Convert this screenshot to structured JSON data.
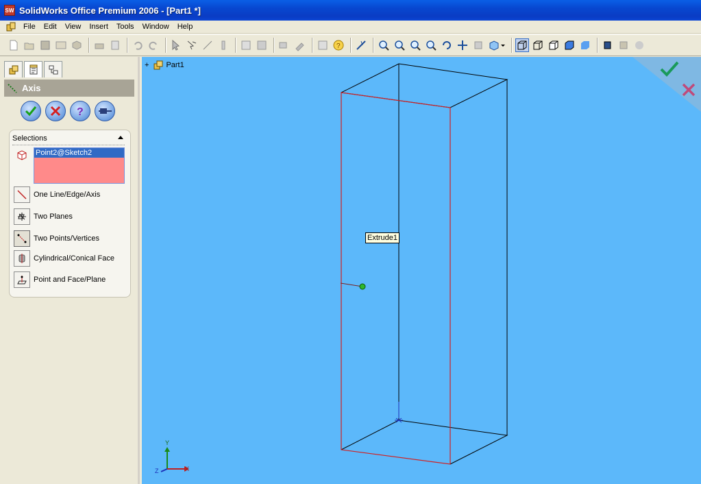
{
  "window": {
    "title": "SolidWorks Office Premium 2006 - [Part1 *]",
    "app_icon": "SW"
  },
  "menu": [
    "File",
    "Edit",
    "View",
    "Insert",
    "Tools",
    "Window",
    "Help"
  ],
  "panel": {
    "header": "Axis",
    "selections_title": "Selections",
    "selected_item": "Point2@Sketch2",
    "options": [
      "One Line/Edge/Axis",
      "Two Planes",
      "Two Points/Vertices",
      "Cylindrical/Conical Face",
      "Point and Face/Plane"
    ],
    "action_buttons": [
      "ok-icon",
      "cancel-icon",
      "help-icon",
      "pushpin-icon"
    ]
  },
  "viewport": {
    "tree_root": "Part1",
    "tree_expander": "+",
    "tooltip": "Extrude1",
    "triad": {
      "x": "X",
      "y": "Y",
      "z": "Z"
    },
    "background": "#5cb8fa"
  },
  "colors": {
    "selection_list": "#ff8a8a",
    "edge_highlight": "#d22020",
    "title_bar": "#0a5fe6"
  }
}
